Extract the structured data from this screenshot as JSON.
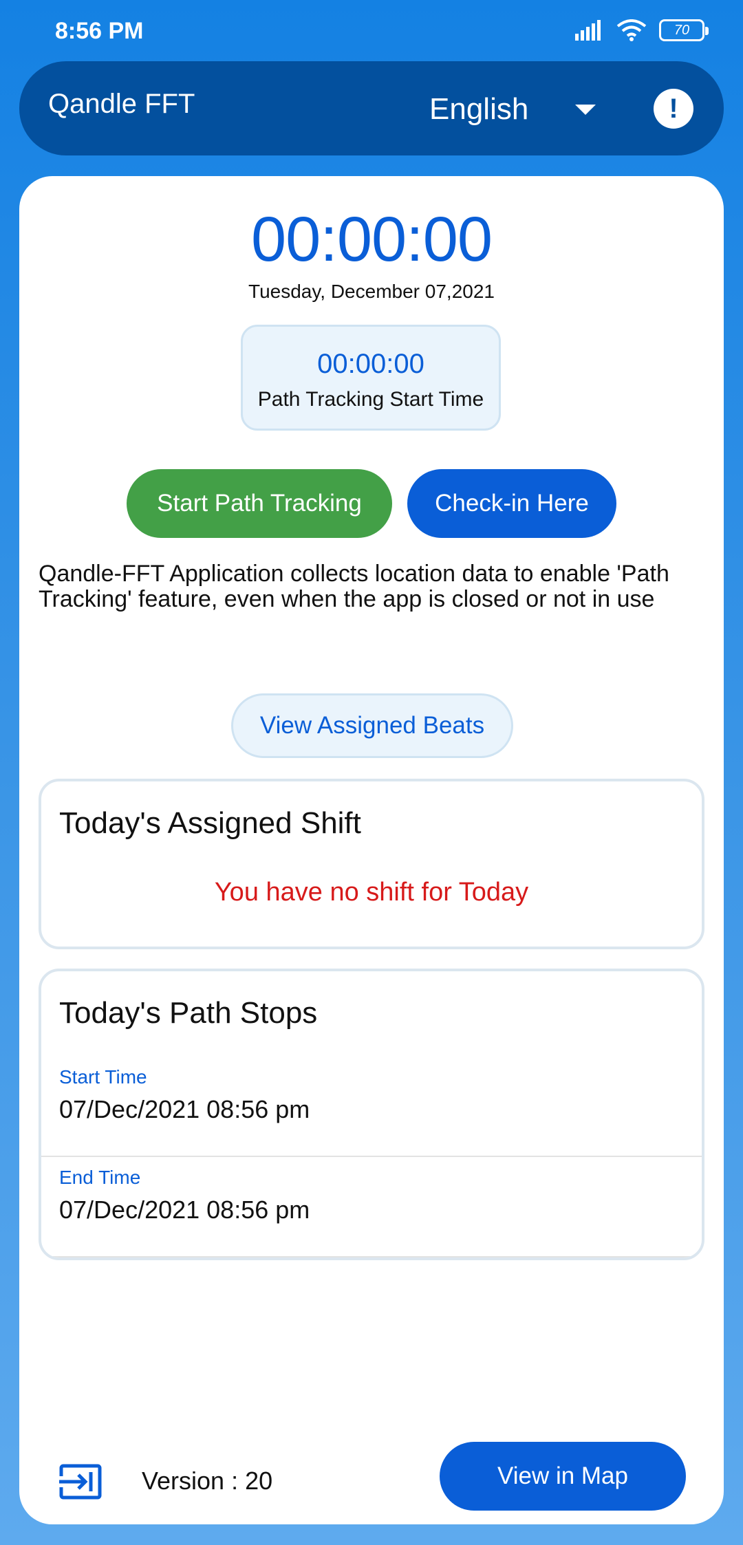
{
  "status_bar": {
    "time": "8:56 PM",
    "battery": "70",
    "icons": [
      "signal-icon",
      "wifi-icon",
      "battery-icon"
    ]
  },
  "header": {
    "title": "Qandle FFT",
    "language": "English",
    "info_symbol": "!"
  },
  "timer": {
    "value": "00:00:00",
    "date": "Tuesday, December 07,2021"
  },
  "path_tracking": {
    "start_time": "00:00:00",
    "start_time_label": "Path Tracking Start Time"
  },
  "actions": {
    "start_tracking": "Start Path Tracking",
    "check_in": "Check-in Here",
    "view_beats": "View Assigned Beats",
    "view_map": "View in Map"
  },
  "disclaimer": "Qandle-FFT Application collects location data to enable 'Path Tracking' feature, even when the app is closed or not in use",
  "shift": {
    "title": "Today's Assigned Shift",
    "message": "You have no shift for Today"
  },
  "path_stops": {
    "title": "Today's Path Stops",
    "items": [
      {
        "label": "Start Time",
        "value": "07/Dec/2021 08:56 pm"
      },
      {
        "label": "End Time",
        "value": "07/Dec/2021 08:56 pm"
      }
    ]
  },
  "footer": {
    "version": "Version : 20"
  },
  "colors": {
    "primary": "#0a5ed7",
    "header_bg": "#03509e",
    "success": "#43a047",
    "error": "#d71a1a"
  }
}
